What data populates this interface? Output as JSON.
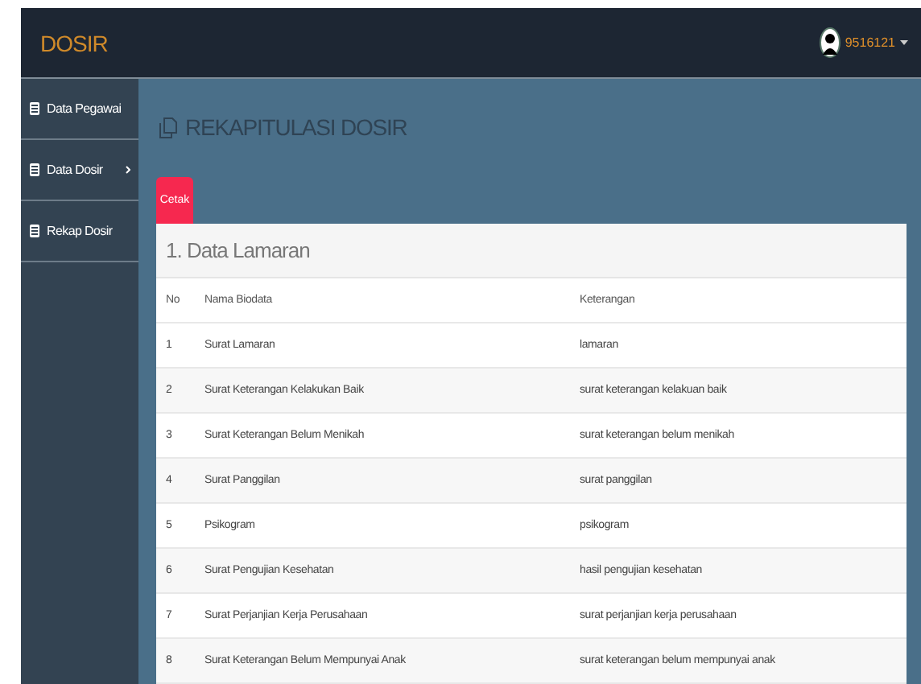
{
  "brand": "DOSIR",
  "user": {
    "name": "9516121"
  },
  "sidebar": {
    "items": [
      {
        "label": "Data Pegawai",
        "has_submenu": false,
        "selected": false
      },
      {
        "label": "Data Dosir",
        "has_submenu": true,
        "selected": false
      },
      {
        "label": "Rekap Dosir",
        "has_submenu": false,
        "selected": false
      }
    ]
  },
  "page_title": "REKAPITULASI DOSIR",
  "print_button": "Cetak",
  "section_title": "1. Data Lamaran",
  "table": {
    "columns": [
      "No",
      "Nama Biodata",
      "Keterangan"
    ],
    "rows": [
      [
        "1",
        "Surat Lamaran",
        "lamaran"
      ],
      [
        "2",
        "Surat Keterangan Kelakukan Baik",
        "surat keterangan kelakuan baik"
      ],
      [
        "3",
        "Surat Keterangan Belum Menikah",
        "surat keterangan belum menikah"
      ],
      [
        "4",
        "Surat Panggilan",
        "surat panggilan"
      ],
      [
        "5",
        "Psikogram",
        "psikogram"
      ],
      [
        "6",
        "Surat Pengujian Kesehatan",
        "hasil pengujian kesehatan"
      ],
      [
        "7",
        "Surat Perjanjian Kerja Perusahaan",
        "surat perjanjian kerja perusahaan"
      ],
      [
        "8",
        "Surat Keterangan Belum Mempunyai Anak",
        "surat keterangan belum mempunyai anak"
      ]
    ]
  }
}
